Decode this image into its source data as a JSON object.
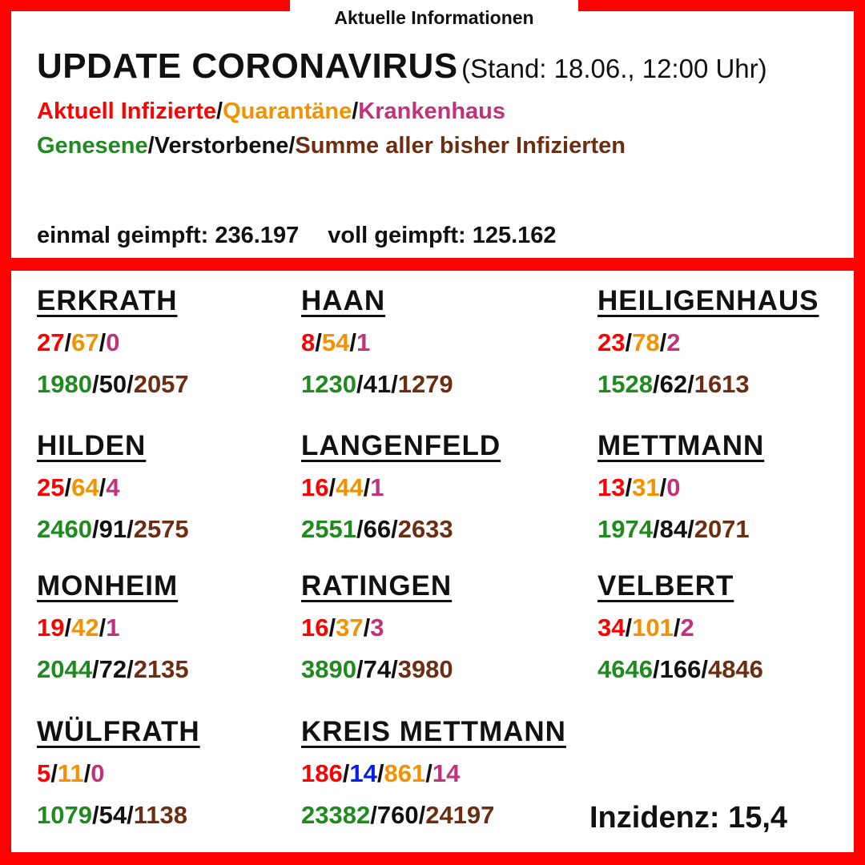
{
  "header": {
    "tab_label": "Aktuelle Informationen"
  },
  "title": {
    "main": "UPDATE CORONAVIRUS",
    "stand": "(Stand: 18.06., 12:00 Uhr)"
  },
  "legend": {
    "active": "Aktuell Infizierte",
    "quarantine": "Quarantäne",
    "hospital": "Krankenhaus",
    "recovered": "Genesene",
    "deceased": "Verstorbene",
    "total": "Summe aller bisher Infizierten",
    "separator": "/"
  },
  "vaccination": {
    "first_label": "einmal geimpft:",
    "first_value": "236.197",
    "full_label": "voll geimpft:",
    "full_value": "125.162"
  },
  "cities": [
    {
      "name": "ERKRATH",
      "active": "27",
      "quarantine": "67",
      "hospital": "0",
      "recovered": "1980",
      "deceased": "50",
      "total": "2057"
    },
    {
      "name": "HAAN",
      "active": "8",
      "quarantine": "54",
      "hospital": "1",
      "recovered": "1230",
      "deceased": "41",
      "total": "1279"
    },
    {
      "name": "HEILIGENHAUS",
      "active": "23",
      "quarantine": "78",
      "hospital": "2",
      "recovered": "1528",
      "deceased": "62",
      "total": "1613"
    },
    {
      "name": "HILDEN",
      "active": "25",
      "quarantine": "64",
      "hospital": "4",
      "recovered": "2460",
      "deceased": "91",
      "total": "2575"
    },
    {
      "name": "LANGENFELD",
      "active": "16",
      "quarantine": "44",
      "hospital": "1",
      "recovered": "2551",
      "deceased": "66",
      "total": "2633"
    },
    {
      "name": "METTMANN",
      "active": "13",
      "quarantine": "31",
      "hospital": "0",
      "recovered": "1974",
      "deceased": "84",
      "total": "2071"
    },
    {
      "name": "MONHEIM",
      "active": "19",
      "quarantine": "42",
      "hospital": "1",
      "recovered": "2044",
      "deceased": "72",
      "total": "2135"
    },
    {
      "name": "RATINGEN",
      "active": "16",
      "quarantine": "37",
      "hospital": "3",
      "recovered": "3890",
      "deceased": "74",
      "total": "3980"
    },
    {
      "name": "VELBERT",
      "active": "34",
      "quarantine": "101",
      "hospital": "2",
      "recovered": "4646",
      "deceased": "166",
      "total": "4846"
    },
    {
      "name": "WÜLFRATH",
      "active": "5",
      "quarantine": "11",
      "hospital": "0",
      "recovered": "1079",
      "deceased": "54",
      "total": "1138"
    }
  ],
  "kreis": {
    "name": "KREIS METTMANN",
    "active": "186",
    "blue_value": "14",
    "quarantine": "861",
    "hospital": "14",
    "recovered": "23382",
    "deceased": "760",
    "total": "24197"
  },
  "incidence": {
    "label": "Inzidenz:",
    "value": "15,4"
  },
  "colors": {
    "frame": "#ff0000",
    "active": "#ff0000",
    "quarantine": "#f39200",
    "hospital": "#c0337a",
    "recovered": "#1f8b1f",
    "deceased": "#111111",
    "total": "#6b2e12",
    "kreis_extra": "#0a1ee6"
  }
}
